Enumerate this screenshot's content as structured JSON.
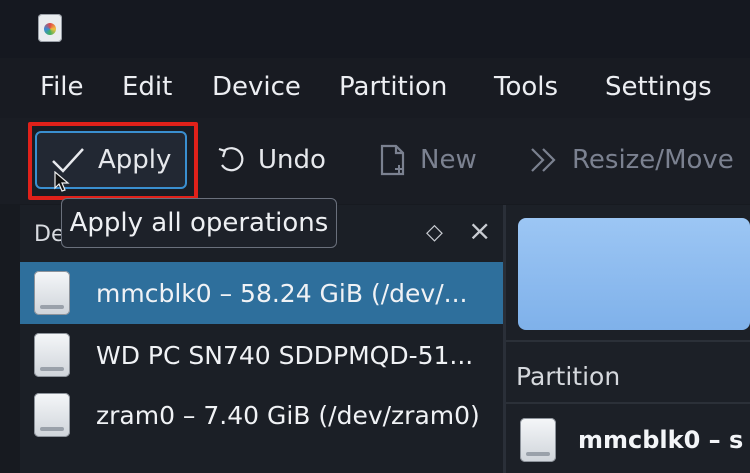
{
  "window": {
    "app_icon": "partition-manager-app-icon"
  },
  "menu": {
    "items": [
      {
        "label": "File"
      },
      {
        "label": "Edit"
      },
      {
        "label": "Device"
      },
      {
        "label": "Partition"
      },
      {
        "label": "Tools"
      },
      {
        "label": "Settings"
      }
    ]
  },
  "toolbar": {
    "apply_label": "Apply",
    "undo_label": "Undo",
    "new_label": "New",
    "resize_label": "Resize/Move",
    "tooltip": "Apply all operations"
  },
  "devices_panel": {
    "header_label": "De",
    "float_icon": "diamond-icon",
    "close_icon": "close-icon",
    "devices": [
      {
        "label": "mmcblk0 – 58.24 GiB (/dev/...",
        "selected": true
      },
      {
        "label": "WD PC SN740 SDDPMQD-51...",
        "selected": false
      },
      {
        "label": "zram0 – 7.40 GiB (/dev/zram0)",
        "selected": false
      }
    ]
  },
  "partition_panel": {
    "heading": "Partition",
    "row_label": "mmcblk0 – s"
  },
  "colors": {
    "selection": "#2e6f9c",
    "highlight_box": "#e0211a",
    "focus_border": "#3a8fd0",
    "partition_graphic": "#8fbcf0"
  }
}
